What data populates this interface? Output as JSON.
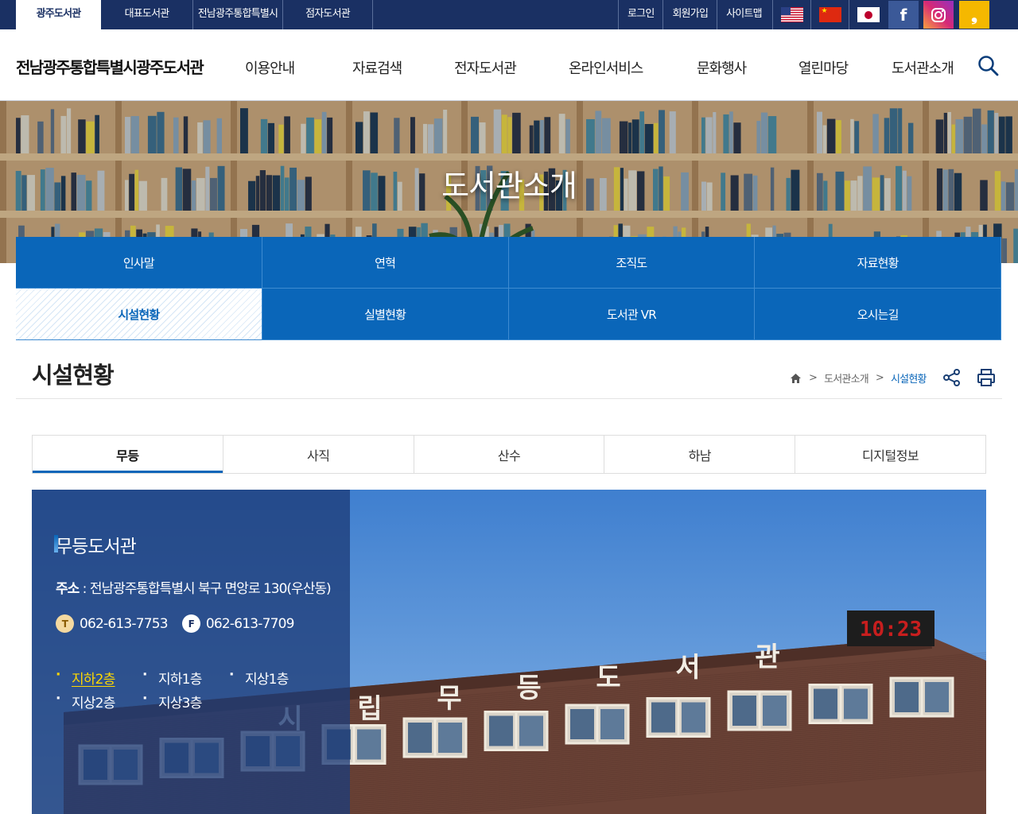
{
  "topbar": {
    "tabs": [
      "광주도서관",
      "대표도서관",
      "전남광주통합특별시",
      "점자도서관"
    ],
    "util": [
      "로그인",
      "회원가입",
      "사이트맵"
    ],
    "languages": [
      "english",
      "chinese",
      "japanese"
    ],
    "sns": [
      "facebook",
      "instagram",
      "kakao-story"
    ]
  },
  "header": {
    "logo": "전남광주통합특별시광주도서관",
    "gnb": [
      "이용안내",
      "자료검색",
      "전자도서관",
      "온라인서비스",
      "문화행사",
      "열린마당",
      "도서관소개"
    ]
  },
  "hero": {
    "title": "도서관소개"
  },
  "lnb": [
    "인사말",
    "연혁",
    "조직도",
    "자료현황",
    "시설현황",
    "실별현황",
    "도서관 VR",
    "오시는길"
  ],
  "lnb_active": "시설현황",
  "page": {
    "title": "시설현황",
    "breadcrumb": [
      "도서관소개",
      "시설현황"
    ]
  },
  "subtabs": [
    "무등",
    "사직",
    "산수",
    "하남",
    "디지털정보"
  ],
  "subtab_active": "무등",
  "library": {
    "name": "무등도서관",
    "addr_label": "주소",
    "address": " : 전남광주통합특별시 북구 면앙로 130(우산동)",
    "tel_icon": "T",
    "tel": "062-613-7753",
    "fax_icon": "F",
    "fax": "062-613-7709",
    "floors": [
      "지하2층",
      "지하1층",
      "지상1층",
      "지상2층",
      "지상3층"
    ],
    "floor_active": "지하2층",
    "clock": "10:23",
    "sign_chars": [
      "시",
      "립",
      "무",
      "등",
      "도",
      "서",
      "관"
    ]
  },
  "colors": {
    "topbar": "#1a3063",
    "lnb": "#0a66b9",
    "active_floor": "#ffd800"
  }
}
